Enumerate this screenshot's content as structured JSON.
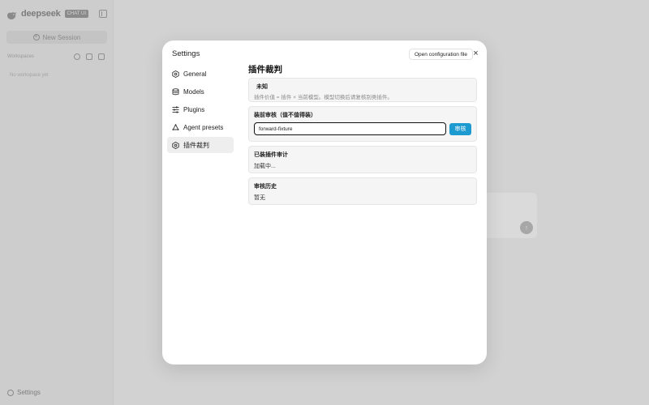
{
  "app": {
    "brand_name": "deepseek",
    "brand_badge": "CHAT UI",
    "new_session_label": "New Session",
    "workspaces_title": "Workspaces",
    "no_workspace_text": "No workspace yet",
    "settings_label": "Settings"
  },
  "settings": {
    "title": "Settings",
    "open_config_label": "Open configuration file",
    "close_icon": "×",
    "nav": [
      {
        "label": "General",
        "icon": "general-icon"
      },
      {
        "label": "Models",
        "icon": "models-icon"
      },
      {
        "label": "Plugins",
        "icon": "plugins-icon"
      },
      {
        "label": "Agent presets",
        "icon": "agent-presets-icon"
      },
      {
        "label": "插件裁判",
        "icon": "plugin-judge-icon",
        "active": true
      }
    ],
    "section_title": "插件裁判",
    "cards": {
      "unknown_title": "未知",
      "unknown_desc": "插件价值 = 插件 × 当前模型。模型切换后请复核别类插件。",
      "pre_install_title": "装前审核（值不值得装）",
      "review_input_value": "forward-fixture",
      "review_button": "审核",
      "installed_title": "已装插件审计",
      "installed_status": "加载中...",
      "history_title": "审核历史",
      "history_status": "暂无"
    }
  }
}
